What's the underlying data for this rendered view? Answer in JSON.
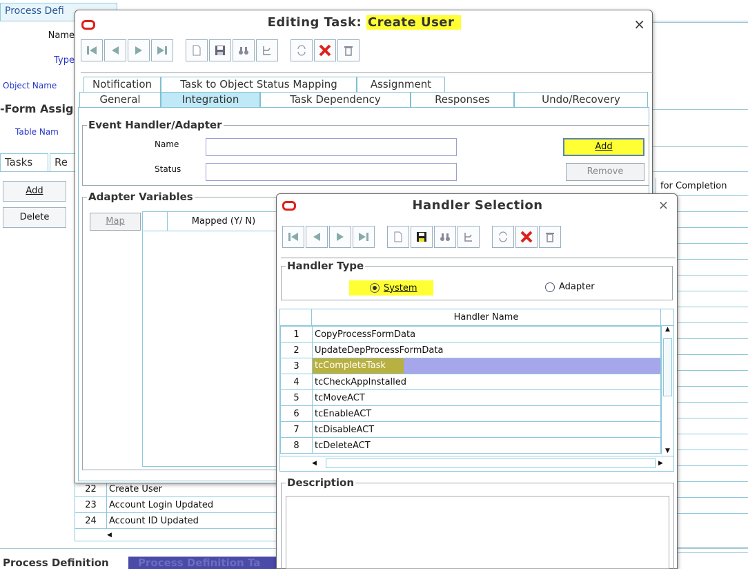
{
  "background": {
    "top_tab": "Process Defi",
    "name_label": "Name",
    "type_label": "Type",
    "object_name_label": "Object Name",
    "form_assign_label": "-Form Assig",
    "table_name_label": "Table Nam",
    "tabs": [
      "Tasks",
      "Re"
    ],
    "add_button": "Add",
    "delete_button": "Delete",
    "for_completion_header": "for Completion",
    "bottom_tabs": [
      "Process Definition",
      "Process Definition Ta"
    ],
    "task_rows": [
      {
        "num": "22",
        "name": "Create User"
      },
      {
        "num": "23",
        "name": "Account Login Updated"
      },
      {
        "num": "24",
        "name": "Account ID Updated"
      }
    ]
  },
  "editing_dialog": {
    "title_prefix": "Editing Task: ",
    "title_task": "Create User",
    "close": "×",
    "tabs_row1": [
      "Notification",
      "Task to Object Status Mapping",
      "Assignment"
    ],
    "tabs_row2": [
      "General",
      "Integration",
      "Task Dependency",
      "Responses",
      "Undo/Recovery"
    ],
    "selected_tab": "Integration",
    "event_handler_group": "Event Handler/Adapter",
    "name_label": "Name",
    "status_label": "Status",
    "name_value": "",
    "status_value": "",
    "add_button": "Add",
    "remove_button": "Remove",
    "adapter_vars_group": "Adapter Variables",
    "map_button": "Map",
    "mapped_header": "Mapped (Y/ N)"
  },
  "handler_dialog": {
    "title": "Handler Selection",
    "close": "×",
    "handler_type_group": "Handler Type",
    "radio_system": "System",
    "radio_adapter": "Adapter",
    "selected_radio": "System",
    "table_header": "Handler Name",
    "rows": [
      {
        "num": "1",
        "name": "CopyProcessFormData"
      },
      {
        "num": "2",
        "name": "UpdateDepProcessFormData"
      },
      {
        "num": "3",
        "name": "tcCompleteTask"
      },
      {
        "num": "4",
        "name": "tcCheckAppInstalled"
      },
      {
        "num": "5",
        "name": "tcMoveACT"
      },
      {
        "num": "6",
        "name": "tcEnableACT"
      },
      {
        "num": "7",
        "name": "tcDisableACT"
      },
      {
        "num": "8",
        "name": "tcDeleteACT"
      }
    ],
    "selected_row": "3",
    "description_group": "Description",
    "description_value": ""
  },
  "colors": {
    "highlight": "#ffff33",
    "selection": "#a6a6ea",
    "oracle_red": "#e0201a",
    "link_blue": "#2436c8"
  }
}
